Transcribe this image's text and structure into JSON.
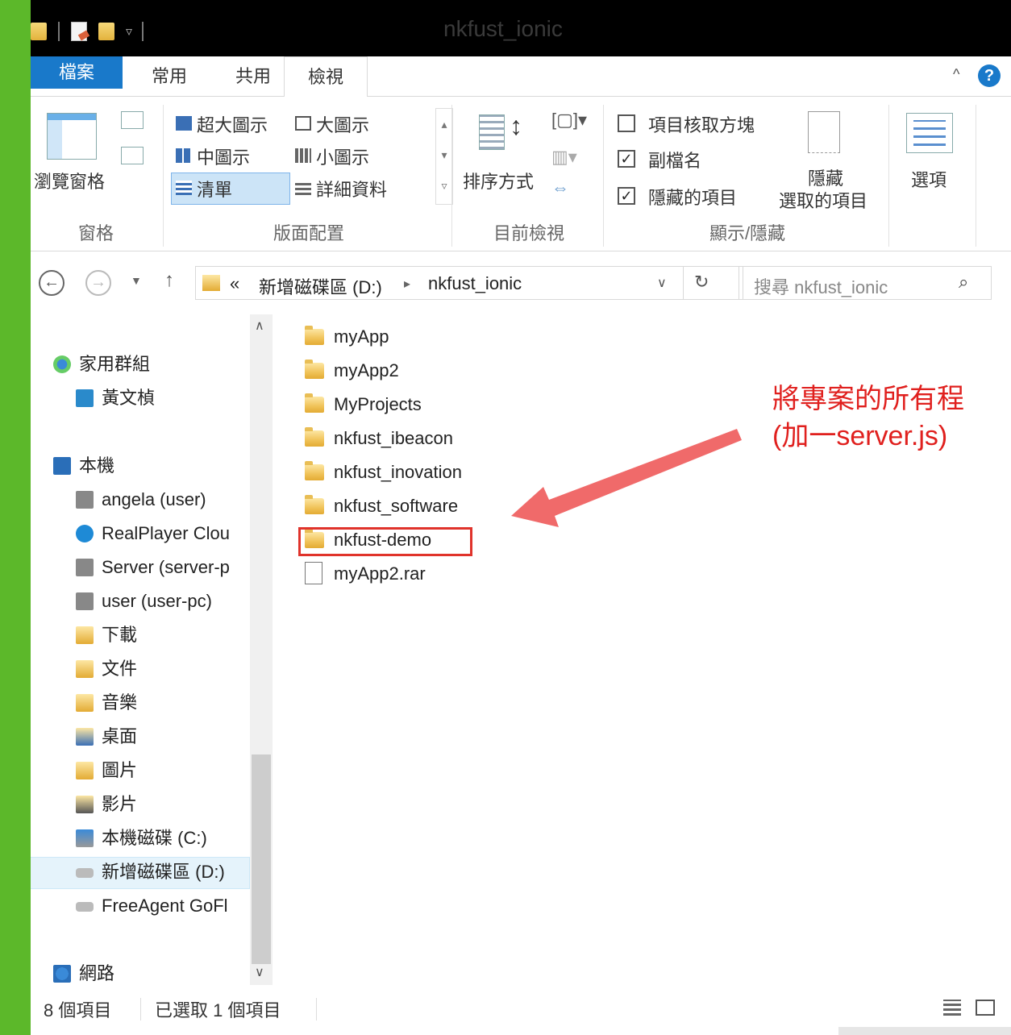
{
  "window": {
    "title": "nkfust_ionic"
  },
  "tabs": {
    "file": "檔案",
    "home": "常用",
    "share": "共用",
    "view": "檢視"
  },
  "ribbon": {
    "pane": {
      "nav_pane": "瀏覽窗格",
      "group_label": "窗格"
    },
    "layout": {
      "xl_icons": "超大圖示",
      "large_icons": "大圖示",
      "medium_icons": "中圖示",
      "small_icons": "小圖示",
      "list": "清單",
      "details": "詳細資料",
      "group_label": "版面配置"
    },
    "current_view": {
      "sort_by": "排序方式",
      "group_label": "目前檢視"
    },
    "show_hide": {
      "item_checkboxes": "項目核取方塊",
      "item_checkboxes_checked": "",
      "file_ext": "副檔名",
      "file_ext_checked": "✓",
      "hidden_items": "隱藏的項目",
      "hidden_items_checked": "✓",
      "hide_selected_line1": "隱藏",
      "hide_selected_line2": "選取的項目",
      "group_label": "顯示/隱藏"
    },
    "options": {
      "label": "選項"
    }
  },
  "address": {
    "chevrons": "«",
    "crumb1": "新增磁碟區 (D:)",
    "arrow": "▸",
    "crumb2": "nkfust_ionic",
    "search_placeholder": "搜尋 nkfust_ionic"
  },
  "nav": {
    "homegroup": "家用群組",
    "user_hg": "黃文楨",
    "this_pc": "本機",
    "angela": "angela (user)",
    "realplayer": "RealPlayer Clou",
    "server": "Server (server-p",
    "user": "user (user-pc)",
    "downloads": "下載",
    "documents": "文件",
    "music": "音樂",
    "desktop": "桌面",
    "pictures": "圖片",
    "videos": "影片",
    "drive_c": "本機磁碟 (C:)",
    "drive_d": "新增磁碟區 (D:)",
    "freeagent": "FreeAgent GoFl",
    "network": "網路"
  },
  "files": [
    "myApp",
    "myApp2",
    "MyProjects",
    "nkfust_ibeacon",
    "nkfust_inovation",
    "nkfust_software",
    "nkfust-demo",
    "myApp2.rar"
  ],
  "annotation": {
    "line1": "將專案的所有程",
    "line2": "(加一server.js)"
  },
  "status": {
    "count": "8 個項目",
    "selected": "已選取 1 個項目"
  },
  "colors": {
    "accent": "#1979ca",
    "annotation": "#e0201e",
    "desktop_bg": "#5cb82a"
  }
}
